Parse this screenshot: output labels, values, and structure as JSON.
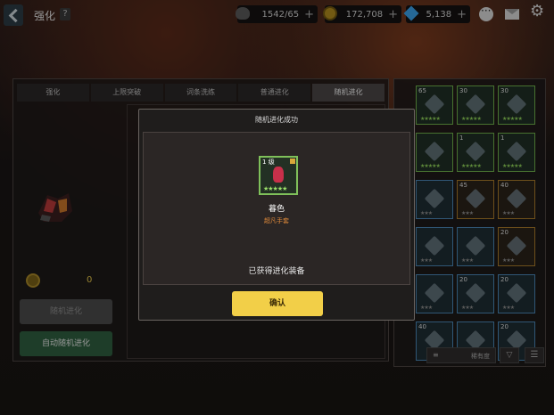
{
  "header": {
    "title": "强化",
    "help_label": "?",
    "stamina": "1542/65",
    "gold": "172,708",
    "gems": "5,138",
    "plus": "+"
  },
  "tabs": [
    {
      "label": "强化",
      "active": false
    },
    {
      "label": "上限突破",
      "active": false
    },
    {
      "label": "词条洗练",
      "active": false
    },
    {
      "label": "普通进化",
      "active": false
    },
    {
      "label": "随机进化",
      "active": true
    }
  ],
  "left": {
    "gold_cost": "0",
    "random_evolve_label": "随机进化",
    "auto_random_evolve_label": "自动随机进化"
  },
  "inventory": {
    "slots": [
      {
        "lvl": "65",
        "stars": "★★★★★",
        "tier": "green"
      },
      {
        "lvl": "30",
        "stars": "★★★★★",
        "tier": "green"
      },
      {
        "lvl": "30",
        "stars": "★★★★★",
        "tier": "green"
      },
      {
        "lvl": "",
        "stars": "★★★★★",
        "tier": "green"
      },
      {
        "lvl": "1",
        "stars": "★★★★★",
        "tier": "green"
      },
      {
        "lvl": "1",
        "stars": "★★★★★",
        "tier": "green"
      },
      {
        "lvl": "",
        "stars": "★★★",
        "tier": "blue"
      },
      {
        "lvl": "45",
        "stars": "★★★",
        "tier": "gold"
      },
      {
        "lvl": "40",
        "stars": "★★★",
        "tier": "gold"
      },
      {
        "lvl": "",
        "stars": "★★★",
        "tier": "blue"
      },
      {
        "lvl": "",
        "stars": "★★★",
        "tier": "blue"
      },
      {
        "lvl": "20",
        "stars": "★★★",
        "tier": "gold"
      },
      {
        "lvl": "",
        "stars": "★★★",
        "tier": "blue"
      },
      {
        "lvl": "20",
        "stars": "★★★",
        "tier": "blue"
      },
      {
        "lvl": "20",
        "stars": "★★★",
        "tier": "blue"
      },
      {
        "lvl": "40",
        "stars": "",
        "tier": "blue"
      },
      {
        "lvl": "",
        "stars": "",
        "tier": "blue"
      },
      {
        "lvl": "20",
        "stars": "",
        "tier": "blue"
      }
    ],
    "sort_label": "稀有度",
    "sort_order_icon": "▽",
    "filter_icon": "☰"
  },
  "modal": {
    "title": "随机进化成功",
    "item_level": "1",
    "item_stars": "★★★★★",
    "item_name": "暮色",
    "item_rarity": "超凡手套",
    "obtained_text": "已获得进化装备",
    "confirm_label": "确认"
  }
}
